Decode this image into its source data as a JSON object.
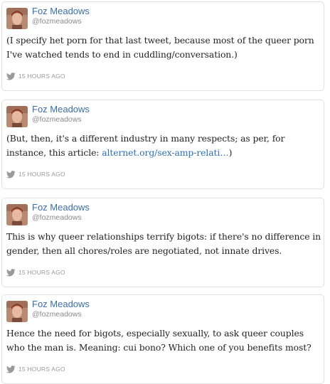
{
  "tweets": [
    {
      "author": {
        "name": "Foz Meadows",
        "handle": "@fozmeadows"
      },
      "text_before": "(I specify het porn for that last tweet, because most of the queer porn I've watched tends to end in cuddling/conversation.)",
      "link": "",
      "text_after": "",
      "time": "15 HOURS AGO"
    },
    {
      "author": {
        "name": "Foz Meadows",
        "handle": "@fozmeadows"
      },
      "text_before": "(But, then, it's a different industry in many respects; as per, for instance, this article: ",
      "link": "alternet.org/sex-amp-relati…",
      "text_after": ")",
      "time": "15 HOURS AGO"
    },
    {
      "author": {
        "name": "Foz Meadows",
        "handle": "@fozmeadows"
      },
      "text_before": "This is why queer relationships terrify bigots: if there's no difference in gender, then all chores/roles are negotiated, not innate drives.",
      "link": "",
      "text_after": "",
      "time": "15 HOURS AGO"
    },
    {
      "author": {
        "name": "Foz Meadows",
        "handle": "@fozmeadows"
      },
      "text_before": "Hence the need for bigots, especially sexually, to ask queer couples who the man is. Meaning: cui bono? Which one of you benefits most?",
      "link": "",
      "text_after": "",
      "time": "15 HOURS AGO"
    }
  ],
  "icons": {
    "avatar": "profile-photo",
    "source": "twitter-bird-icon"
  },
  "colors": {
    "name": "#3b6ea5",
    "link": "#2f6fb0",
    "meta": "#9a9a9a",
    "border": "#e1e1e1"
  }
}
